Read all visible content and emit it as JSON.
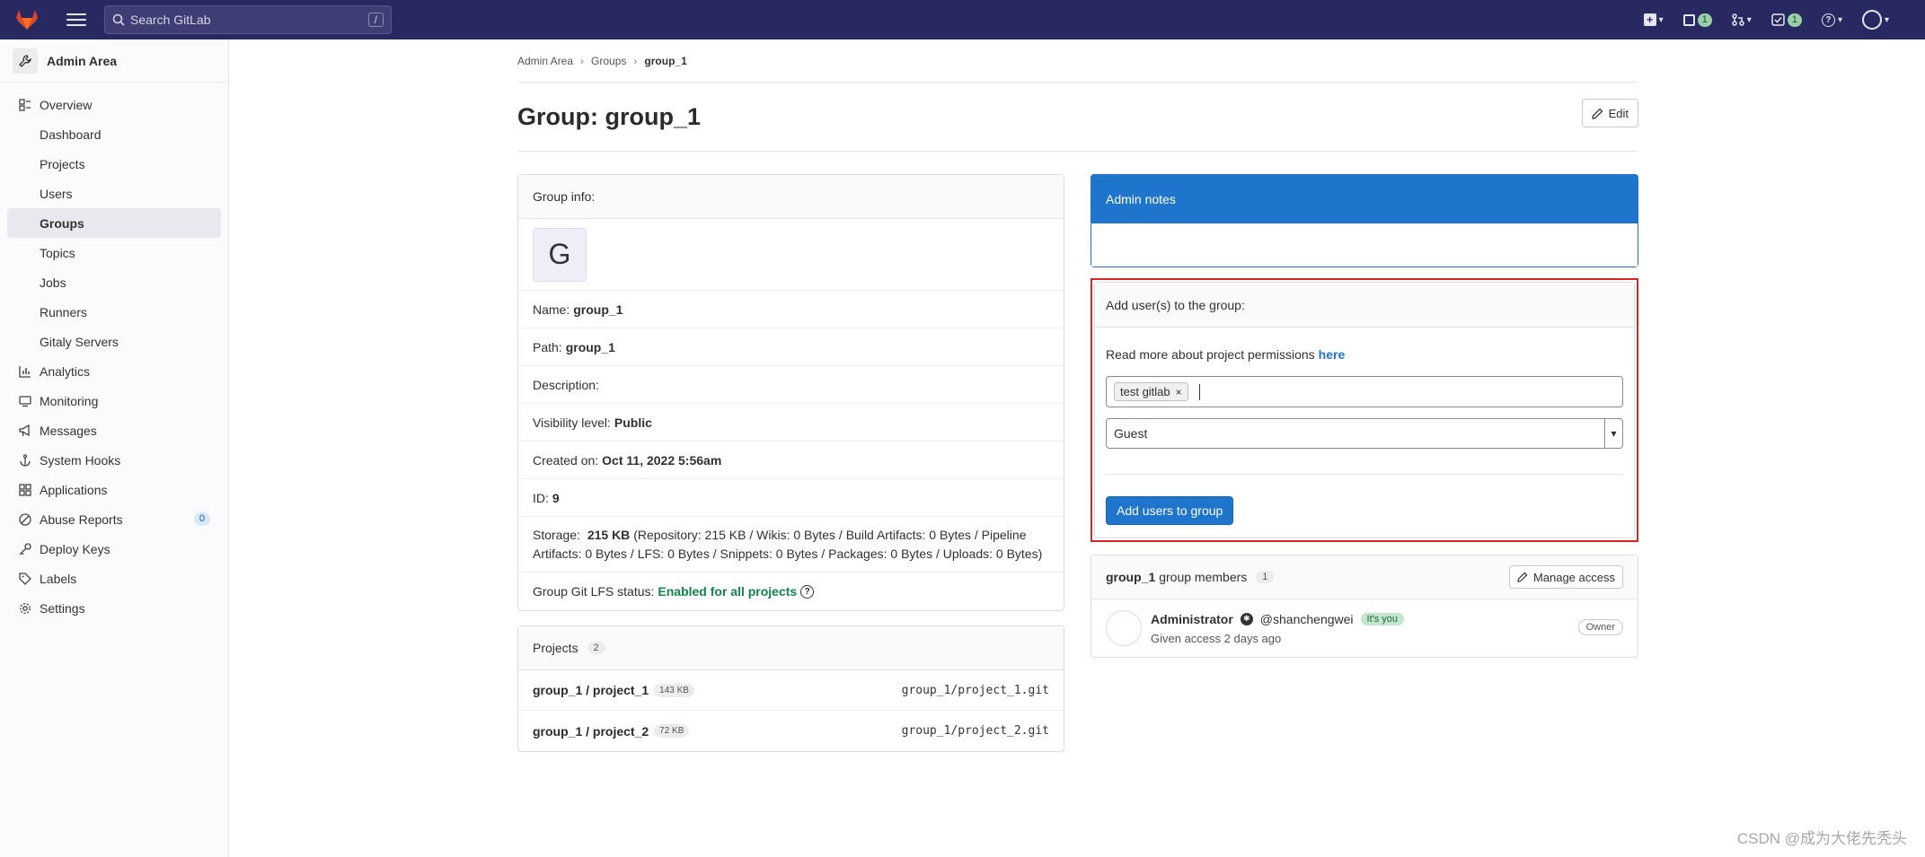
{
  "topbar": {
    "search_placeholder": "Search GitLab",
    "search_shortcut": "/",
    "mr_count": "1",
    "todo_count": "1",
    "issues_count": "1"
  },
  "sidebar": {
    "title": "Admin Area",
    "overview": "Overview",
    "sub_items": [
      "Dashboard",
      "Projects",
      "Users",
      "Groups",
      "Topics",
      "Jobs",
      "Runners",
      "Gitaly Servers"
    ],
    "items": [
      {
        "label": "Analytics",
        "icon": "chart-icon"
      },
      {
        "label": "Monitoring",
        "icon": "monitor-icon"
      },
      {
        "label": "Messages",
        "icon": "bullhorn-icon"
      },
      {
        "label": "System Hooks",
        "icon": "anchor-icon"
      },
      {
        "label": "Applications",
        "icon": "grid-icon"
      },
      {
        "label": "Abuse Reports",
        "icon": "abuse-icon"
      },
      {
        "label": "Deploy Keys",
        "icon": "key-icon"
      },
      {
        "label": "Labels",
        "icon": "label-icon"
      },
      {
        "label": "Settings",
        "icon": "gear-icon"
      }
    ],
    "abuse_count": "0"
  },
  "breadcrumb": {
    "items": [
      "Admin Area",
      "Groups",
      "group_1"
    ]
  },
  "page": {
    "title": "Group: group_1",
    "edit_label": "Edit"
  },
  "group_info": {
    "header": "Group info:",
    "avatar_letter": "G",
    "name_label": "Name:",
    "name_value": "group_1",
    "path_label": "Path:",
    "path_value": "group_1",
    "description_label": "Description:",
    "visibility_label": "Visibility level:",
    "visibility_value": "Public",
    "created_label": "Created on:",
    "created_value": "Oct 11, 2022 5:56am",
    "id_label": "ID:",
    "id_value": "9",
    "storage_label": "Storage:",
    "storage_value": "215 KB",
    "storage_detail": "(Repository: 215 KB / Wikis: 0 Bytes / Build Artifacts: 0 Bytes / Pipeline Artifacts: 0 Bytes / LFS: 0 Bytes / Snippets: 0 Bytes / Packages: 0 Bytes / Uploads: 0 Bytes)",
    "lfs_label": "Group Git LFS status:",
    "lfs_value": "Enabled for all projects"
  },
  "projects": {
    "header": "Projects",
    "count": "2",
    "list": [
      {
        "name": "group_1 / project_1",
        "size": "143 KB",
        "path": "group_1/project_1.git"
      },
      {
        "name": "group_1 / project_2",
        "size": "72 KB",
        "path": "group_1/project_2.git"
      }
    ]
  },
  "admin_notes": {
    "header": "Admin notes"
  },
  "add_users": {
    "header": "Add user(s) to the group:",
    "permissions_text": "Read more about project permissions",
    "permissions_link": "here",
    "token": "test gitlab",
    "role": "Guest",
    "submit_label": "Add users to group"
  },
  "members": {
    "group_name": "group_1",
    "label": "group members",
    "count": "1",
    "manage_label": "Manage access",
    "list": [
      {
        "name": "Administrator",
        "username": "@shanchengwei",
        "tag": "It's you",
        "access": "Given access 2 days ago",
        "role": "Owner"
      }
    ]
  },
  "watermark": "CSDN @成为大佬先秃头"
}
